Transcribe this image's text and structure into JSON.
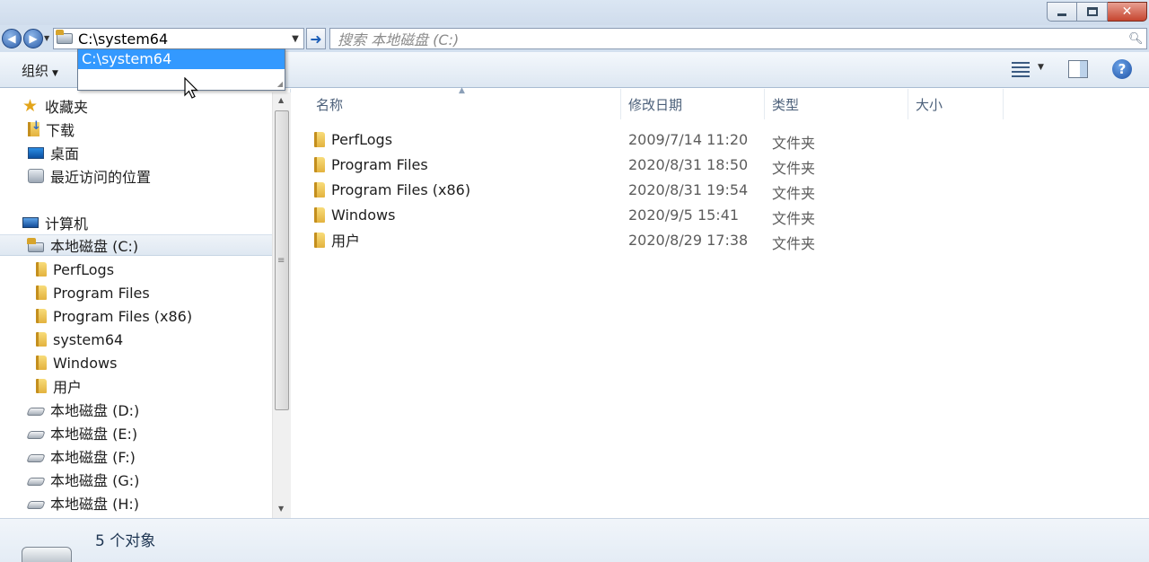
{
  "address": {
    "path": "C:\\system64",
    "search_placeholder": "搜索 本地磁盘 (C:)"
  },
  "autocomplete": {
    "items": [
      "C:\\system64"
    ]
  },
  "toolbar": {
    "organize": "组织"
  },
  "nav": {
    "favorites": "收藏夹",
    "fav_items": [
      "下载",
      "桌面",
      "最近访问的位置"
    ],
    "computer": "计算机",
    "c_drive": "本地磁盘 (C:)",
    "c_children": [
      "PerfLogs",
      "Program Files",
      "Program Files (x86)",
      "system64",
      "Windows",
      "用户"
    ],
    "other_drives": [
      "本地磁盘 (D:)",
      "本地磁盘 (E:)",
      "本地磁盘 (F:)",
      "本地磁盘 (G:)",
      "本地磁盘 (H:)"
    ]
  },
  "columns": {
    "name": "名称",
    "modified": "修改日期",
    "type": "类型",
    "size": "大小"
  },
  "files": [
    {
      "name": "PerfLogs",
      "modified": "2009/7/14 11:20",
      "type": "文件夹"
    },
    {
      "name": "Program Files",
      "modified": "2020/8/31 18:50",
      "type": "文件夹"
    },
    {
      "name": "Program Files (x86)",
      "modified": "2020/8/31 19:54",
      "type": "文件夹"
    },
    {
      "name": "Windows",
      "modified": "2020/9/5 15:41",
      "type": "文件夹"
    },
    {
      "name": "用户",
      "modified": "2020/8/29 17:38",
      "type": "文件夹"
    }
  ],
  "status": {
    "count": "5 个对象"
  }
}
